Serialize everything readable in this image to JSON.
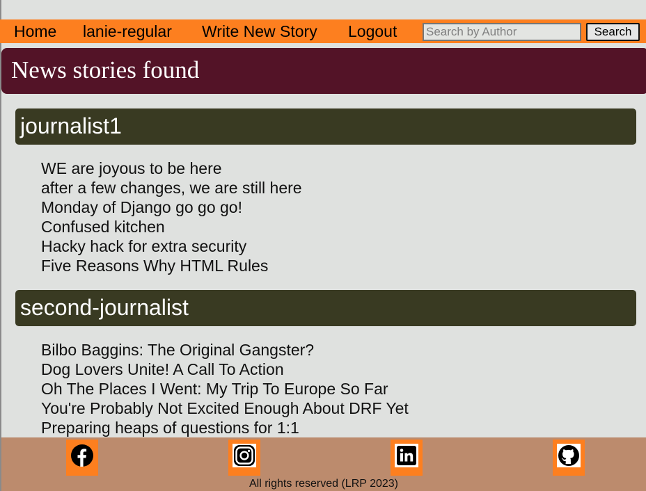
{
  "nav": {
    "links": [
      "Home",
      "lanie-regular",
      "Write New Story",
      "Logout"
    ],
    "search_placeholder": "Search by Author",
    "search_button": "Search"
  },
  "page_title": "News stories found",
  "authors": [
    {
      "name": "journalist1",
      "stories": [
        "WE are joyous to be here",
        "after a few changes, we are still here",
        "Monday of Django go go go!",
        "Confused kitchen",
        "Hacky hack for extra security",
        "Five Reasons Why HTML Rules"
      ]
    },
    {
      "name": "second-journalist",
      "stories": [
        "Bilbo Baggins: The Original Gangster?",
        "Dog Lovers Unite! A Call To Action",
        "Oh The Places I Went: My Trip To Europe So Far",
        "You're Probably Not Excited Enough About DRF Yet",
        "Preparing heaps of questions for 1:1"
      ]
    }
  ],
  "footer": {
    "social_icons": [
      "facebook-icon",
      "instagram-icon",
      "linkedin-icon",
      "github-icon"
    ],
    "copyright": "All rights reserved (LRP 2023)"
  },
  "colors": {
    "nav": "#fd7f1f",
    "title_bar": "#531327",
    "author_header": "#393a22",
    "footer": "#bc8b6d",
    "background": "#dfe1df"
  }
}
